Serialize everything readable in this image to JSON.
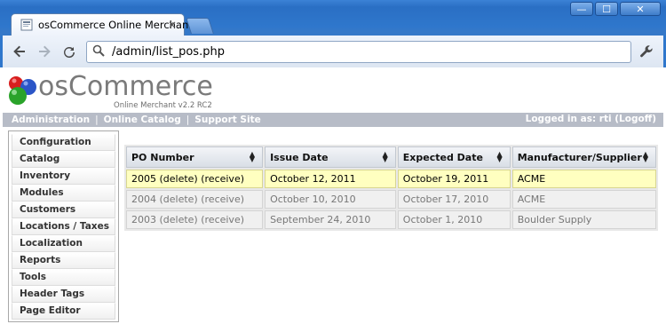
{
  "browser": {
    "tab_title": "osCommerce Online Merchant",
    "tab_close": "×",
    "url": "/admin/list_pos.php",
    "window_buttons": [
      "—",
      "☐",
      "✕"
    ]
  },
  "brand": {
    "logo_text": "osCommerce",
    "subtitle": "Online Merchant v2.2 RC2"
  },
  "header_nav": {
    "links": [
      "Administration",
      "Online Catalog",
      "Support Site"
    ],
    "separator": "|",
    "login_status": "Logged in as: rti (Logoff)"
  },
  "sidebar": {
    "items": [
      {
        "label": "Configuration"
      },
      {
        "label": "Catalog"
      },
      {
        "label": "Inventory"
      },
      {
        "label": "Modules"
      },
      {
        "label": "Customers"
      },
      {
        "label": "Locations / Taxes"
      },
      {
        "label": "Localization"
      },
      {
        "label": "Reports"
      },
      {
        "label": "Tools"
      },
      {
        "label": "Header Tags"
      },
      {
        "label": "Page Editor"
      }
    ]
  },
  "po_table": {
    "columns": [
      "PO Number",
      "Issue Date",
      "Expected Date",
      "Manufacturer/Supplier"
    ],
    "rows": [
      {
        "po": "2005 (delete) (receive)",
        "issue": "October 12, 2011",
        "expected": "October 19, 2011",
        "supplier": "ACME",
        "highlighted": true
      },
      {
        "po": "2004 (delete) (receive)",
        "issue": "October 10, 2010",
        "expected": "October 17, 2010",
        "supplier": "ACME",
        "highlighted": false
      },
      {
        "po": "2003 (delete) (receive)",
        "issue": "September 24, 2010",
        "expected": "October 1, 2010",
        "supplier": "Boulder Supply",
        "highlighted": false
      }
    ]
  },
  "colors": {
    "highlight_row": "#ffffc0",
    "nav_bar": "#b7bcc7",
    "chrome_blue": "#2f77cc"
  }
}
